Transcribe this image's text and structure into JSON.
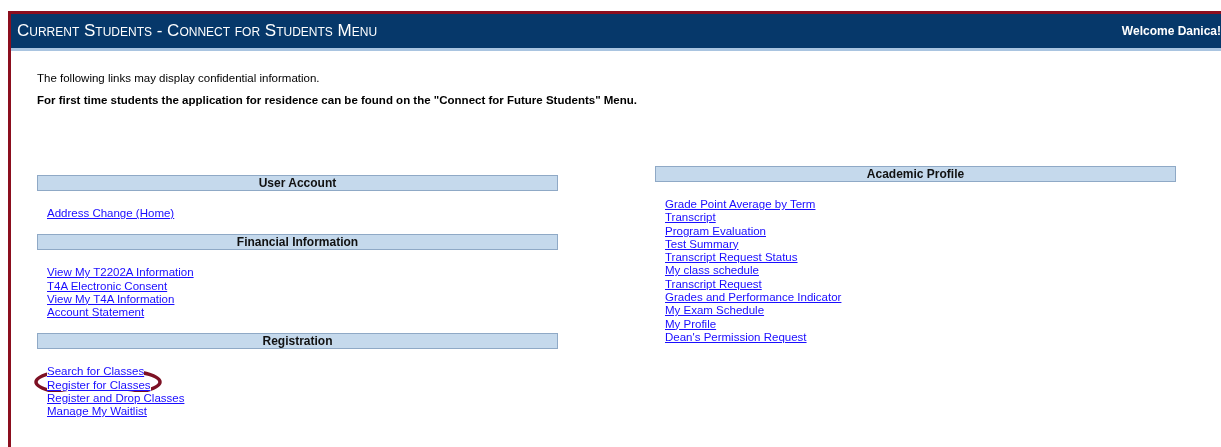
{
  "header": {
    "title": "Current Students - Connect for Students Menu",
    "welcome": "Welcome Danica!"
  },
  "intro": {
    "note": "The following links may display confidential information.",
    "notice": "For first time students the application for residence can be found on the \"Connect for Future Students\" Menu."
  },
  "left_sections": [
    {
      "title": "User Account",
      "links": [
        {
          "label": "Address Change (Home)",
          "circled": false
        }
      ]
    },
    {
      "title": "Financial Information",
      "links": [
        {
          "label": "View My T2202A Information",
          "circled": false
        },
        {
          "label": "T4A Electronic Consent",
          "circled": false
        },
        {
          "label": "View My T4A Information",
          "circled": false
        },
        {
          "label": "Account Statement",
          "circled": false
        }
      ]
    },
    {
      "title": "Registration",
      "links": [
        {
          "label": "Search for Classes",
          "circled": false
        },
        {
          "label": "Register for Classes",
          "circled": true
        },
        {
          "label": "Register and Drop Classes",
          "circled": false
        },
        {
          "label": "Manage My Waitlist",
          "circled": false
        }
      ]
    }
  ],
  "right_sections": [
    {
      "title": "Academic Profile",
      "links": [
        {
          "label": "Grade Point Average by Term",
          "circled": false
        },
        {
          "label": "Transcript",
          "circled": false
        },
        {
          "label": "Program Evaluation",
          "circled": false
        },
        {
          "label": "Test Summary",
          "circled": false
        },
        {
          "label": "Transcript Request Status",
          "circled": false
        },
        {
          "label": "My class schedule",
          "circled": false
        },
        {
          "label": "Transcript Request",
          "circled": false
        },
        {
          "label": "Grades and Performance Indicator",
          "circled": false
        },
        {
          "label": "My Exam Schedule",
          "circled": false
        },
        {
          "label": "My Profile",
          "circled": false
        },
        {
          "label": "Dean's Permission Request",
          "circled": false
        }
      ]
    }
  ]
}
